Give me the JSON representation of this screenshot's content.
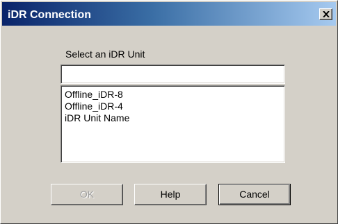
{
  "window": {
    "title": "iDR Connection",
    "close_glyph": "×"
  },
  "form": {
    "label": "Select an iDR Unit",
    "input_value": ""
  },
  "list": {
    "items": [
      {
        "label": "Offline_iDR-8"
      },
      {
        "label": "Offline_iDR-4"
      },
      {
        "label": "iDR Unit Name"
      }
    ]
  },
  "buttons": {
    "ok": {
      "label": "OK",
      "enabled": false
    },
    "help": {
      "label": "Help",
      "enabled": true
    },
    "cancel": {
      "label": "Cancel",
      "enabled": true,
      "default": true
    }
  },
  "colors": {
    "title_gradient_start": "#0a246a",
    "title_gradient_end": "#a6caf0",
    "dialog_face": "#d4d0c8",
    "disabled_text": "#a0a0a0"
  },
  "icons": {
    "close": "close-icon"
  }
}
